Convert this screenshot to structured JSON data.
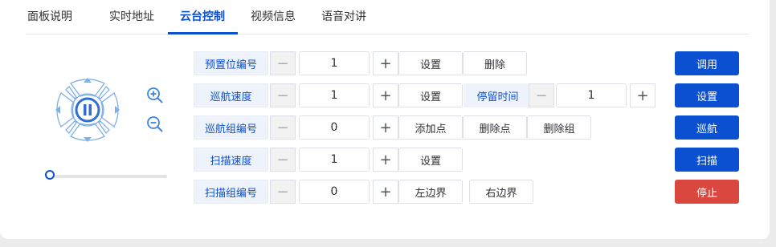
{
  "tabs": [
    {
      "label": "面板说明"
    },
    {
      "label": "实时地址"
    },
    {
      "label": "云台控制"
    },
    {
      "label": "视频信息"
    },
    {
      "label": "语音对讲"
    }
  ],
  "active_tab": "云台控制",
  "ptz": {
    "speed_fraction": 0.0
  },
  "rows": {
    "preset": {
      "label": "预置位编号",
      "value": "1",
      "minus": "−",
      "plus": "+",
      "set": "设置",
      "delete": "删除"
    },
    "cruise_speed": {
      "label": "巡航速度",
      "value": "1",
      "minus": "−",
      "plus": "+",
      "set": "设置",
      "dwell_label": "停留时间",
      "dwell_value": "1"
    },
    "cruise_group": {
      "label": "巡航组编号",
      "value": "0",
      "minus": "−",
      "plus": "+",
      "add_point": "添加点",
      "delete_point": "删除点",
      "delete_group": "删除组"
    },
    "scan_speed": {
      "label": "扫描速度",
      "value": "1",
      "minus": "−",
      "plus": "+",
      "set": "设置"
    },
    "scan_group": {
      "label": "扫描组编号",
      "value": "0",
      "minus": "−",
      "plus": "+",
      "left_border": "左边界",
      "right_border": "右边界"
    }
  },
  "actions": {
    "call": "调用",
    "set": "设置",
    "cruise": "巡航",
    "scan": "扫描",
    "stop": "停止"
  },
  "colors": {
    "primary": "#0b50d0",
    "danger": "#d9473f",
    "label_bg": "#eef2fb"
  }
}
